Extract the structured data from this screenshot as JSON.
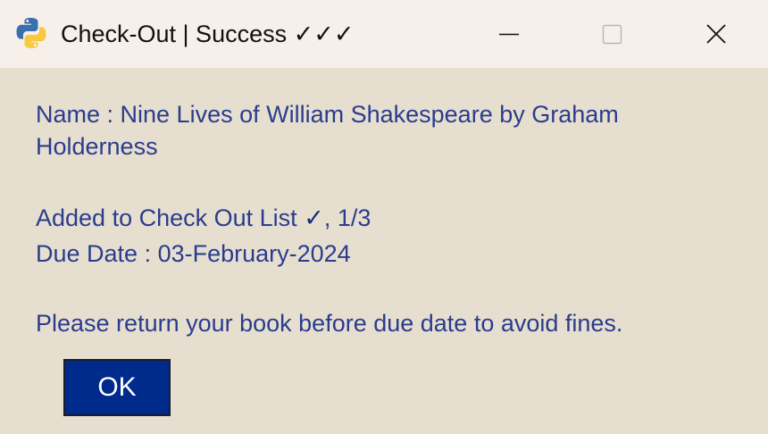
{
  "window": {
    "title": "Check-Out | Success ✓✓✓",
    "app_icon": "python-icon",
    "controls": {
      "minimize_icon": "minimize-icon",
      "maximize_icon": "maximize-icon",
      "close_icon": "close-icon"
    }
  },
  "message": {
    "name_line_1": "Name : Nine Lives of William Shakespeare by Graham",
    "name_line_2": "Holderness",
    "added_text": "Added to Check Out List",
    "added_check": "✓",
    "added_count": ", 1/3",
    "due_date": "Due Date : 03-February-2024",
    "notice": "Please return your book before due date to avoid fines."
  },
  "ok_button_label": "OK",
  "colors": {
    "background": "#e6dfd0",
    "titlebar": "#f7f0ea",
    "text": "#2b3c8c",
    "button": "#002a8c"
  }
}
